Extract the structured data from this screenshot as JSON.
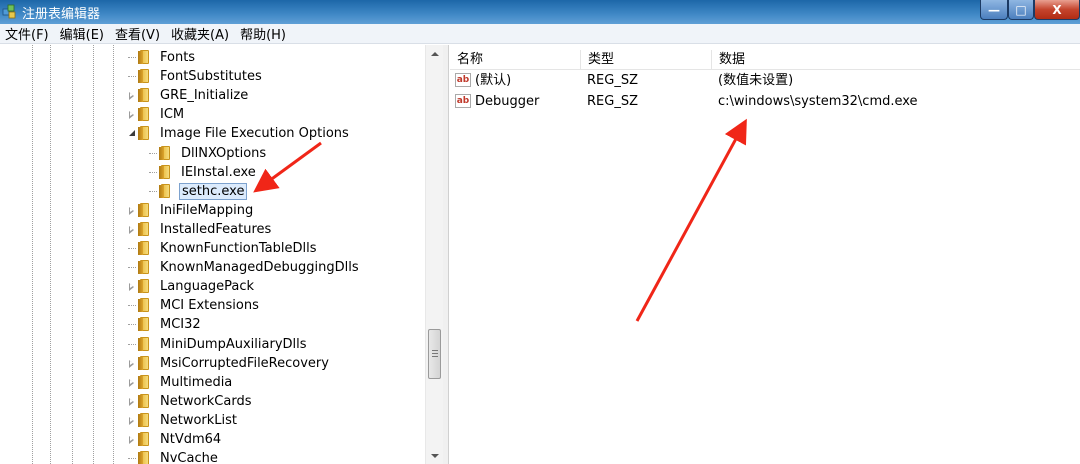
{
  "window": {
    "title": "注册表编辑器",
    "controls": {
      "minimize": "—",
      "maximize": "□",
      "close": "X"
    }
  },
  "menu": [
    "文件(F)",
    "编辑(E)",
    "查看(V)",
    "收藏夹(A)",
    "帮助(H)"
  ],
  "tree": {
    "items": [
      {
        "label": "Fonts",
        "depth": 0,
        "expander": "none"
      },
      {
        "label": "FontSubstitutes",
        "depth": 0,
        "expander": "none"
      },
      {
        "label": "GRE_Initialize",
        "depth": 0,
        "expander": "collapsed"
      },
      {
        "label": "ICM",
        "depth": 0,
        "expander": "collapsed"
      },
      {
        "label": "Image File Execution Options",
        "depth": 0,
        "expander": "expanded"
      },
      {
        "label": "DllNXOptions",
        "depth": 1,
        "expander": "none"
      },
      {
        "label": "IEInstal.exe",
        "depth": 1,
        "expander": "none"
      },
      {
        "label": "sethc.exe",
        "depth": 1,
        "expander": "none",
        "selected": true
      },
      {
        "label": "IniFileMapping",
        "depth": 0,
        "expander": "collapsed"
      },
      {
        "label": "InstalledFeatures",
        "depth": 0,
        "expander": "collapsed"
      },
      {
        "label": "KnownFunctionTableDlls",
        "depth": 0,
        "expander": "none"
      },
      {
        "label": "KnownManagedDebuggingDlls",
        "depth": 0,
        "expander": "none"
      },
      {
        "label": "LanguagePack",
        "depth": 0,
        "expander": "collapsed"
      },
      {
        "label": "MCI Extensions",
        "depth": 0,
        "expander": "none"
      },
      {
        "label": "MCI32",
        "depth": 0,
        "expander": "none"
      },
      {
        "label": "MiniDumpAuxiliaryDlls",
        "depth": 0,
        "expander": "none"
      },
      {
        "label": "MsiCorruptedFileRecovery",
        "depth": 0,
        "expander": "collapsed"
      },
      {
        "label": "Multimedia",
        "depth": 0,
        "expander": "collapsed"
      },
      {
        "label": "NetworkCards",
        "depth": 0,
        "expander": "collapsed"
      },
      {
        "label": "NetworkList",
        "depth": 0,
        "expander": "collapsed"
      },
      {
        "label": "NtVdm64",
        "depth": 0,
        "expander": "collapsed"
      },
      {
        "label": "NvCache",
        "depth": 0,
        "expander": "none"
      }
    ]
  },
  "list": {
    "columns": [
      "名称",
      "类型",
      "数据"
    ],
    "rows": [
      {
        "icon": "ab",
        "name": "(默认)",
        "type": "REG_SZ",
        "data": "(数值未设置)"
      },
      {
        "icon": "ab",
        "name": "Debugger",
        "type": "REG_SZ",
        "data": "c:\\windows\\system32\\cmd.exe"
      }
    ]
  },
  "colors": {
    "annotation_arrow": "#f02618",
    "selection_bg": "#dcebfc",
    "titlebar": "#3d86c4"
  }
}
